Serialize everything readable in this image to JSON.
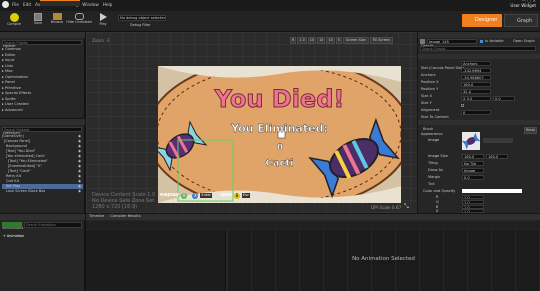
{
  "menu": [
    "File",
    "Edit",
    "Asset",
    "View",
    "Debug",
    "Window",
    "Help"
  ],
  "tab_title": "Gameover Screen",
  "title_right": "User Widget",
  "toolbar": {
    "buttons": [
      "Compile",
      "Save",
      "Browse",
      "Hide Unrelated",
      "Play"
    ],
    "debug_filter": "No debug object selected",
    "debug_filter_label": "Debug Filter",
    "mode_designer": "Designer",
    "mode_graph": "Graph"
  },
  "palette": {
    "title": "Palette",
    "search_placeholder": "Search Palette",
    "categories": [
      "Common",
      "Editor",
      "Input",
      "Lists",
      "Misc",
      "Optimization",
      "Panel",
      "Primitive",
      "Special Effects",
      "Sprite",
      "User Created",
      "Advanced"
    ]
  },
  "hierarchy": {
    "title": "Hierarchy",
    "search_placeholder": "Search Widgets",
    "items": [
      "[GameOver]",
      "[Canvas Panel]",
      "Background",
      "[Text] \"You Died\"",
      "[You eliminated] Cacti",
      "[Text] \"You Eliminated\"",
      "[EnemiesKilled] \"0\"",
      "[Text] \"Cacti\"",
      "Retry Kit",
      "Quit Kit",
      "Set Play",
      "Lose Screen Black Box"
    ]
  },
  "canvas": {
    "zoom": "Zoom -3",
    "title": "You Died!",
    "eliminated": "You Eliminated:",
    "count": "0",
    "cacti": "Cacti",
    "retry": "Replay",
    "retry_key": "A",
    "retry_key2": "X",
    "retry_key3": "Enter",
    "quit": "Quit",
    "quit_key": "B",
    "quit_key2": "Esc",
    "info1": "Device Content Scale 1.0",
    "info2": "No Device Safe Zone Set",
    "info3": "1280 x 720 (16:9)",
    "dpi": "DPI Scale 0.67",
    "toolbar_items": [
      "Screen Size",
      "Fill Screen"
    ],
    "toggles": [
      "R",
      "1.0",
      "10",
      "10",
      "10",
      "5"
    ]
  },
  "details": {
    "title": "Details",
    "name": "Image_145",
    "is_variable": "Is Variable",
    "open_graph": "Open Graph",
    "search_placeholder": "Search Details",
    "slot_header": "Slot (Canvas Panel Slot)",
    "anchors_label": "Anchors",
    "anchors_value": "Anchors",
    "rows": [
      {
        "label": "Position X",
        "value": "-242.6694"
      },
      {
        "label": "Position Y",
        "value": "-34.986607"
      },
      {
        "label": "Size X",
        "value": "160.0"
      },
      {
        "label": "Size Y",
        "value": "32.0"
      },
      {
        "label": "Alignment",
        "value": "X 0.0"
      },
      {
        "label": "Size To Content",
        "value": ""
      },
      {
        "label": "ZOrder",
        "value": "0"
      }
    ],
    "alignment_y": "0.0",
    "appearance_header": "Appearance",
    "brush": "Brush",
    "image_label": "Image",
    "image_size_label": "Image Size",
    "image_size_x": "160.0",
    "image_size_y": "160.0",
    "tiling_label": "Tiling",
    "tiling_value": "No Tile",
    "draw_as_label": "Draw As",
    "draw_as_value": "Image",
    "margin_label": "Margin",
    "margin_value": "0.0",
    "tint_label": "Tint",
    "color_label": "Color and Opacity",
    "r_label": "R",
    "r_value": "1.0",
    "g_label": "G",
    "g_value": "1.0",
    "b_label": "B",
    "b_value": "1.0",
    "a_label": "A",
    "a_value": "1.0",
    "reset": "Reset"
  },
  "bottom": {
    "animations_title": "Animations",
    "add_animation": "+ Animation",
    "search_animations": "Search Animations",
    "timeline_title": "Timeline",
    "compiler_tab": "Compiler Results",
    "no_animation": "No Animation Selected"
  },
  "colors": {
    "canvas_bg": "#d4c2a4",
    "tablecloth": "#e0a469",
    "title_pink": "#f0738f",
    "accent_orange": "#ef7f1f",
    "selection_blue": "#4b6b9a"
  }
}
